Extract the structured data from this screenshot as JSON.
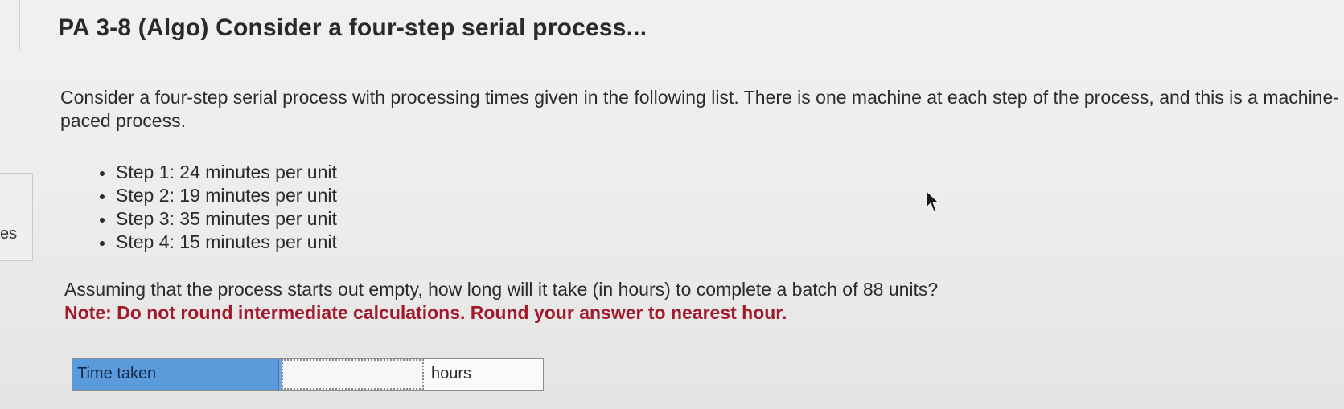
{
  "sidebar": {
    "label": "es"
  },
  "question": {
    "title": "PA 3-8 (Algo) Consider a four-step serial process...",
    "intro": "Consider a four-step serial process with processing times given in the following list. There is one machine at each step of the process, and this is a machine-paced process.",
    "steps": [
      "Step 1: 24 minutes per unit",
      "Step 2: 19 minutes per unit",
      "Step 3: 35 minutes per unit",
      "Step 4: 15 minutes per unit"
    ],
    "ask": "Assuming that the process starts out empty, how long will it take (in hours) to complete a batch of 88 units?",
    "note": "Note: Do not round intermediate calculations. Round your answer to nearest hour."
  },
  "answer": {
    "label": "Time taken",
    "value": "",
    "unit": "hours"
  },
  "colors": {
    "note": "#a3192a",
    "label_bg": "#5b9bdc"
  },
  "icons": {
    "cursor": "mouse-pointer-icon"
  }
}
